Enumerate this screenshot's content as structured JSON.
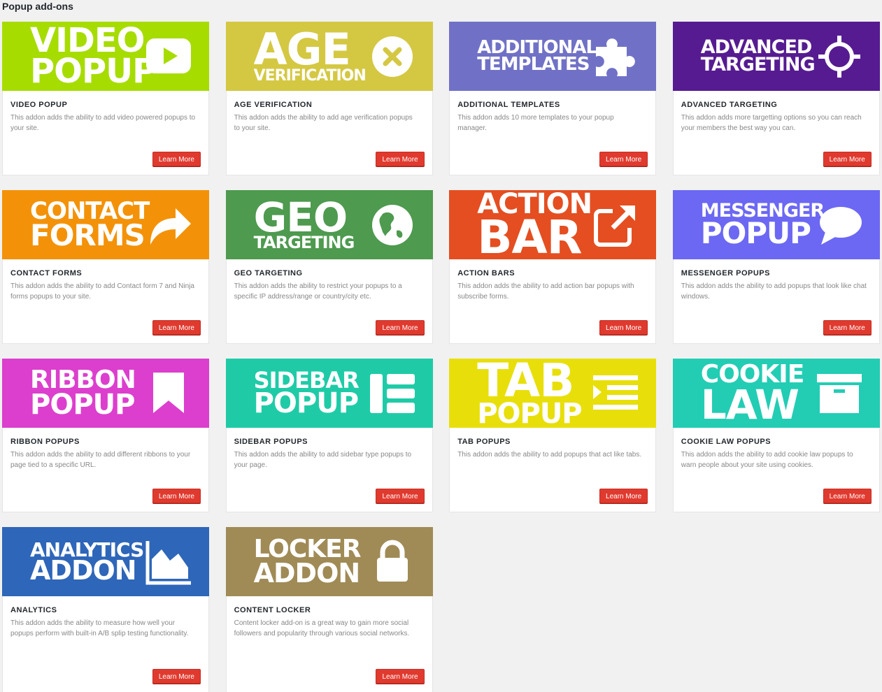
{
  "page": {
    "title": "Popup add-ons"
  },
  "cards": [
    {
      "banner_line1": "VIDEO",
      "banner_line2": "POPUP",
      "title": "VIDEO POPUP",
      "description": "This addon adds the ability to add video powered popups to your site.",
      "button": "Learn More",
      "color": "#a7dc00",
      "icon": "play-icon"
    },
    {
      "banner_line1": "AGE",
      "banner_line2": "VERIFICATION",
      "title": "AGE VERIFICATION",
      "description": "This addon adds the ability to add age verification popups to your site.",
      "button": "Learn More",
      "color": "#d4c843",
      "icon": "close-circle-icon"
    },
    {
      "banner_line1": "ADDITIONAL",
      "banner_line2": "TEMPLATES",
      "title": "ADDITIONAL TEMPLATES",
      "description": "This addon adds 10 more templates to your popup manager.",
      "button": "Learn More",
      "color": "#7071c6",
      "icon": "puzzle-icon"
    },
    {
      "banner_line1": "ADVANCED",
      "banner_line2": "TARGETING",
      "title": "ADVANCED TARGETING",
      "description": "This addon adds more targetting options so you can reach your members the best way you can.",
      "button": "Learn More",
      "color": "#561b91",
      "icon": "crosshair-icon"
    },
    {
      "banner_line1": "CONTACT",
      "banner_line2": "FORMS",
      "title": "CONTACT FORMS",
      "description": "This addon adds the ability to add Contact form 7 and Ninja forms popups to your site.",
      "button": "Learn More",
      "color": "#f39208",
      "icon": "share-arrow-icon"
    },
    {
      "banner_line1": "GEO",
      "banner_line2": "TARGETING",
      "title": "GEO TARGETING",
      "description": "This addon adds the ability to restrict your popups to a specific IP address/range or country/city etc.",
      "button": "Learn More",
      "color": "#4e9a4f",
      "icon": "globe-icon"
    },
    {
      "banner_line1": "ACTION",
      "banner_line2": "BAR",
      "title": "ACTION BARS",
      "description": "This addon adds the ability to add action bar popups with subscribe forms.",
      "button": "Learn More",
      "color": "#e44e21",
      "icon": "external-link-icon"
    },
    {
      "banner_line1": "MESSENGER",
      "banner_line2": "POPUP",
      "title": "MESSENGER POPUPS",
      "description": "This addon adds the ability to add popups that look like chat windows.",
      "button": "Learn More",
      "color": "#6c68f3",
      "icon": "chat-bubble-icon"
    },
    {
      "banner_line1": "RIBBON",
      "banner_line2": "POPUP",
      "title": "RIBBON POPUPS",
      "description": "This addon adds the ability to add different ribbons to your page tied to a specific URL.",
      "button": "Learn More",
      "color": "#dc3fcd",
      "icon": "bookmark-icon"
    },
    {
      "banner_line1": "SIDEBAR",
      "banner_line2": "POPUP",
      "title": "SIDEBAR POPUPS",
      "description": "This addon adds the ability to add sidebar type popups to your page.",
      "button": "Learn More",
      "color": "#1fcba7",
      "icon": "sidebar-layout-icon"
    },
    {
      "banner_line1": "TAB",
      "banner_line2": "POPUP",
      "title": "TAB POPUPS",
      "description": "This addon adds the ability to add popups that act like tabs.",
      "button": "Learn More",
      "color": "#e8df0a",
      "icon": "indent-list-icon"
    },
    {
      "banner_line1": "COOKIE",
      "banner_line2": "LAW",
      "title": "COOKIE LAW POPUPS",
      "description": "This addon adds the ability to add cookie law popups to warn people about your site using cookies.",
      "button": "Learn More",
      "color": "#22cdb4",
      "icon": "archive-box-icon"
    },
    {
      "banner_line1": "ANALYTICS",
      "banner_line2": "ADDON",
      "title": "ANALYTICS",
      "description": "This addon adds the ability to measure how well your popups perform with built-in A/B splip testing functionality.",
      "button": "Learn More",
      "color": "#2e66b9",
      "icon": "area-chart-icon"
    },
    {
      "banner_line1": "LOCKER",
      "banner_line2": "ADDON",
      "title": "CONTENT LOCKER",
      "description": "Content locker add-on is a great way to gain more social followers and popularity through various social networks.",
      "button": "Learn More",
      "color": "#a08b56",
      "icon": "lock-icon"
    }
  ]
}
